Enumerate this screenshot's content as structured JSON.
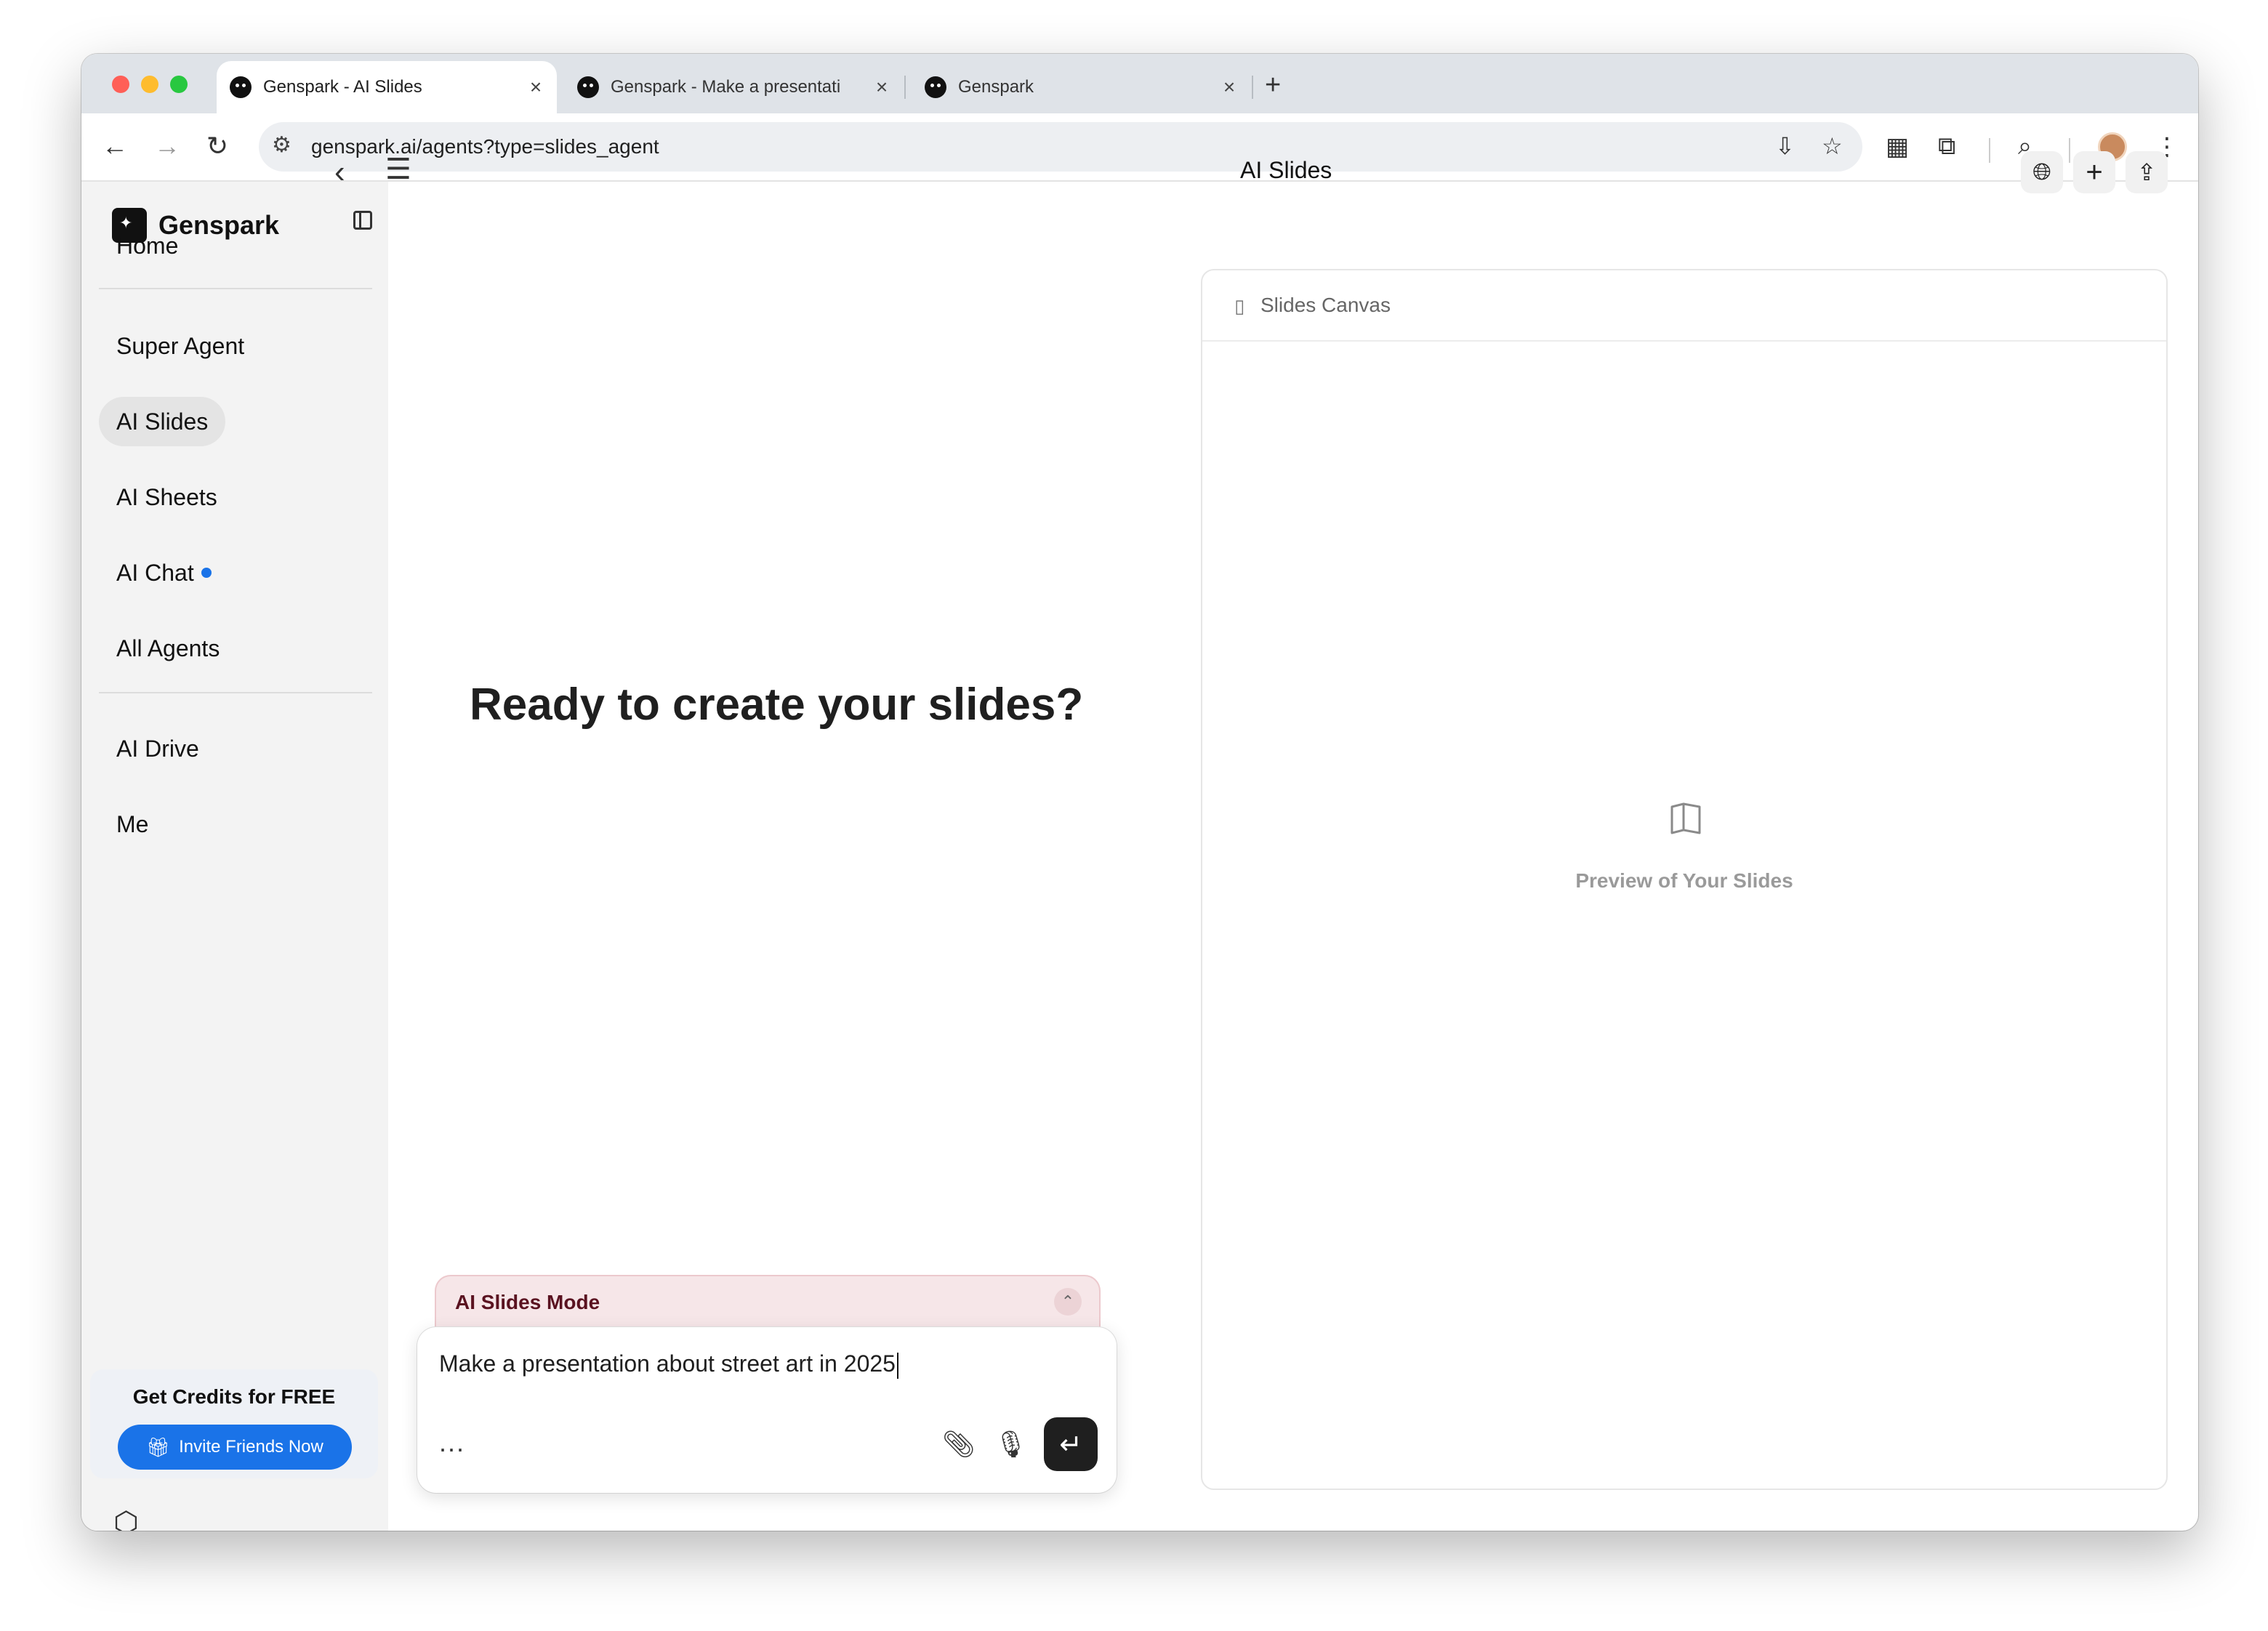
{
  "browser": {
    "tabs": [
      {
        "title": "Genspark - AI Slides",
        "active": true
      },
      {
        "title": "Genspark - Make a presentati",
        "active": false
      },
      {
        "title": "Genspark",
        "active": false
      }
    ],
    "tab_close": "×",
    "new_tab": "+",
    "url": "genspark.ai/agents?type=slides_agent",
    "icons": [
      "back-icon",
      "forward-icon",
      "reload-icon",
      "site-settings-icon",
      "install-app-icon",
      "bookmark-star-icon",
      "extension-icon",
      "puzzle-icon",
      "tab-search-icon",
      "profile-avatar",
      "more-vert-icon"
    ]
  },
  "sidebar": {
    "brand": "Genspark",
    "items": [
      {
        "label": "Home"
      },
      {
        "label": "Super Agent"
      },
      {
        "label": "AI Slides",
        "active": true
      },
      {
        "label": "AI Sheets"
      },
      {
        "label": "AI Chat",
        "badge_dot": true
      },
      {
        "label": "All Agents"
      },
      {
        "label": "AI Drive"
      },
      {
        "label": "Me"
      }
    ],
    "promo": {
      "title": "Get Credits for FREE",
      "button": "Invite Friends Now"
    }
  },
  "header": {
    "title": "AI Slides"
  },
  "main": {
    "headline": "Ready to create your slides?",
    "mode_label": "AI Slides Mode",
    "input_value": "Make a presentation about street art in 2025",
    "more_label": "..."
  },
  "canvas": {
    "header_label": "Slides Canvas",
    "empty_label": "Preview of Your Slides"
  },
  "colors": {
    "accent": "#1a73e8",
    "mode_bg": "#f6e6e8",
    "mode_text": "#5a1220",
    "send_button": "#1f1f1f"
  }
}
